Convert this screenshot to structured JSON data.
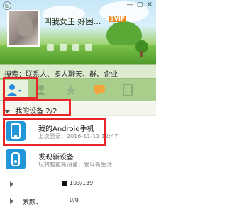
{
  "header": {
    "nickname": "叫我女王 好困…",
    "badge": "SVIP",
    "window_controls": [
      "—",
      "▢",
      "✕"
    ]
  },
  "search": {
    "label": "搜索：联系人、多人聊天、群、企业"
  },
  "tabs": [
    "contacts",
    "groups",
    "favorites",
    "chat",
    "phone"
  ],
  "device_group": {
    "label": "我的设备 2/2"
  },
  "devices": [
    {
      "title": "我的Android手机",
      "sub": "上次登录：2016-11-11 12:47"
    },
    {
      "title": "发现新设备",
      "sub": "玩转智能新设备，发现新生活"
    }
  ],
  "groups": [
    {
      "name": "",
      "count": "103/139"
    },
    {
      "name": "素颜、",
      "count": "0/0"
    }
  ],
  "colors": {
    "accent_red": "#e8262a",
    "device_blue": "#2196d9",
    "grass": "#6fb63f"
  }
}
